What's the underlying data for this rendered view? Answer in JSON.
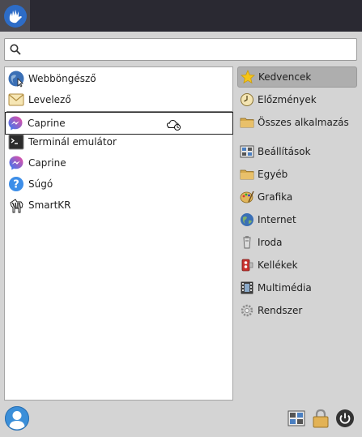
{
  "search": {
    "placeholder": "",
    "value": ""
  },
  "favorites": [
    {
      "label": "Webböngésző",
      "icon": "web-browser-icon"
    },
    {
      "label": "Levelező",
      "icon": "mail-client-icon"
    }
  ],
  "recent": [
    {
      "label": "Caprine",
      "icon": "caprine-icon",
      "selected": true
    },
    {
      "label": "Terminál emulátor",
      "icon": "terminal-icon"
    },
    {
      "label": "Caprine",
      "icon": "caprine-icon"
    },
    {
      "label": "Súgó",
      "icon": "help-icon"
    },
    {
      "label": "SmartKR",
      "icon": "zebra-icon"
    }
  ],
  "categories": [
    {
      "label": "Kedvencek",
      "icon": "star-icon",
      "active": true
    },
    {
      "label": "Előzmények",
      "icon": "history-icon"
    },
    {
      "label": "Összes alkalmazás",
      "icon": "folder-icon"
    },
    {
      "label": "Beállítások",
      "icon": "settings-icon"
    },
    {
      "label": "Egyéb",
      "icon": "folder-icon"
    },
    {
      "label": "Grafika",
      "icon": "graphics-icon"
    },
    {
      "label": "Internet",
      "icon": "globe-icon"
    },
    {
      "label": "Iroda",
      "icon": "office-icon"
    },
    {
      "label": "Kellékek",
      "icon": "accessories-icon"
    },
    {
      "label": "Multimédia",
      "icon": "multimedia-icon"
    },
    {
      "label": "Rendszer",
      "icon": "system-icon"
    }
  ],
  "colors": {
    "topbar": "#2a2932",
    "accent": "#3b8fd9",
    "active_category": "#aeaeae"
  }
}
